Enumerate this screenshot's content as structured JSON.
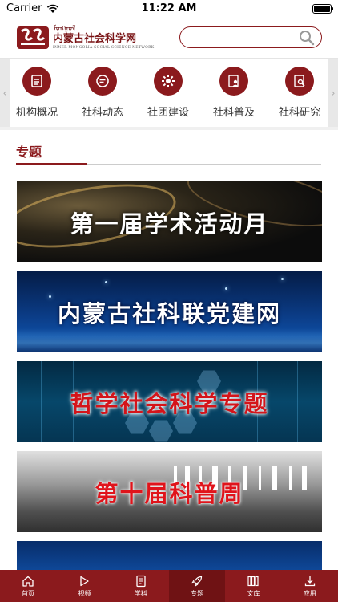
{
  "status_bar": {
    "carrier": "Carrier",
    "time": "11:22 AM",
    "icons": [
      "wifi-icon",
      "battery-icon"
    ]
  },
  "header": {
    "logo": {
      "mongolian_text": "ᠮᠣᠩᠭᠣᠯ",
      "chinese_name": "内蒙古社会科学网",
      "english_name": "INNER MONGOLIA SOCIAL SCIENCE NETWORK"
    },
    "search": {
      "value": "",
      "placeholder": "",
      "icon": "search-icon"
    }
  },
  "category_nav": {
    "items": [
      {
        "label": "机构概况",
        "icon": "document-icon"
      },
      {
        "label": "社科动态",
        "icon": "chat-icon"
      },
      {
        "label": "社团建设",
        "icon": "gear-icon"
      },
      {
        "label": "社科普及",
        "icon": "person-doc-icon"
      },
      {
        "label": "社科研究",
        "icon": "research-icon"
      }
    ]
  },
  "section": {
    "title": "专题"
  },
  "banners": [
    {
      "text": "第一届学术活动月"
    },
    {
      "text": "内蒙古社科联党建网"
    },
    {
      "text": "哲学社会科学专题"
    },
    {
      "text": "第十届科普周"
    },
    {
      "text": ""
    }
  ],
  "tab_bar": {
    "active_index": 3,
    "tabs": [
      {
        "label": "首页",
        "icon": "home-icon"
      },
      {
        "label": "视频",
        "icon": "play-icon"
      },
      {
        "label": "学科",
        "icon": "book-icon"
      },
      {
        "label": "专题",
        "icon": "rocket-icon"
      },
      {
        "label": "文库",
        "icon": "library-icon"
      },
      {
        "label": "应用",
        "icon": "download-icon"
      }
    ]
  },
  "colors": {
    "brand": "#8b1a1d",
    "tab_active": "#6f1214"
  }
}
